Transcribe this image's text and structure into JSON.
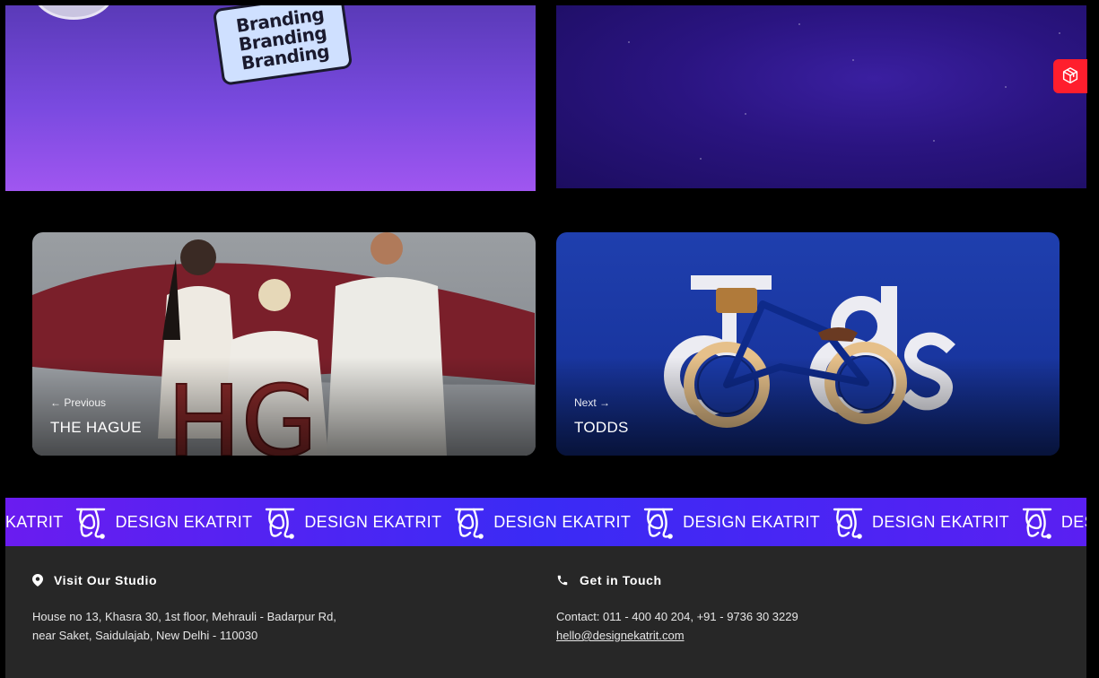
{
  "top_gallery": {
    "sticker_lines": [
      "Branding",
      "Branding",
      "Branding"
    ]
  },
  "floating_button": {
    "icon": "cube-icon",
    "color": "#ff1e2d"
  },
  "prev_project": {
    "label": "← Previous",
    "title": "THE HAGUE"
  },
  "next_project": {
    "label": "Next →",
    "title": "TODDS"
  },
  "marquee": {
    "text": "DESIGN EKATRIT",
    "lead_text": "KATRIT",
    "tail_text": "DES"
  },
  "footer": {
    "studio": {
      "heading": "Visit Our Studio",
      "address_line1": "House no 13, Khasra 30, 1st floor, Mehrauli - Badarpur Rd,",
      "address_line2": "near Saket, Saidulajab, New Delhi - 110030"
    },
    "contact": {
      "heading": "Get in Touch",
      "phones": "Contact: 011 - 400 40 204, +91 - 9736 30 3229",
      "email": "hello@designekatrit.com"
    }
  },
  "colors": {
    "marquee_accent": "#3a2bf5",
    "footer_bg": "#272727",
    "next_card_bg": "#1936a0"
  }
}
